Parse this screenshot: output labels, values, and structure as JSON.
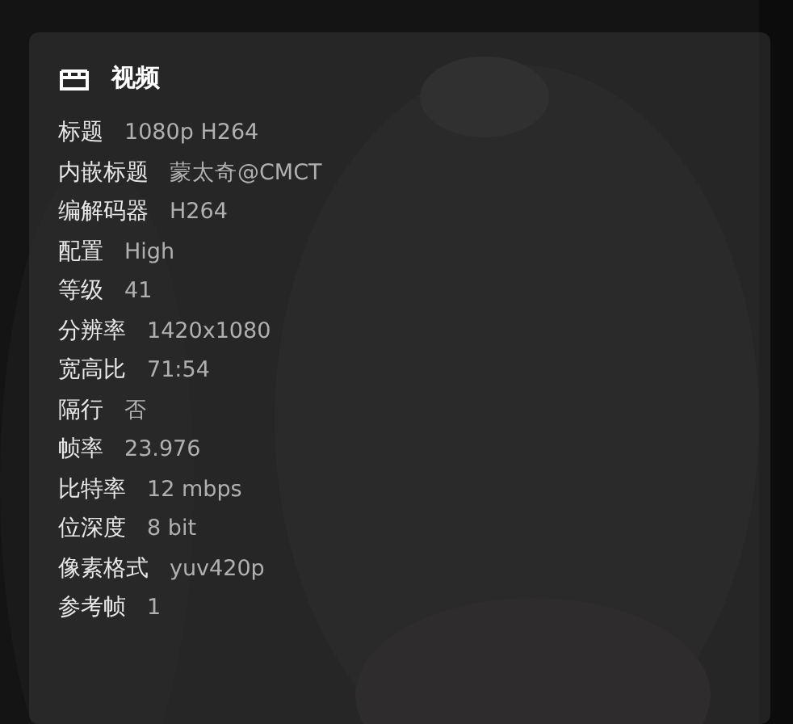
{
  "panel": {
    "title": "视频",
    "rows": [
      {
        "label": "标题",
        "value": "1080p H264"
      },
      {
        "label": "内嵌标题",
        "value": "蒙太奇@CMCT"
      },
      {
        "label": "编解码器",
        "value": "H264"
      },
      {
        "label": "配置",
        "value": "High"
      },
      {
        "label": "等级",
        "value": "41"
      },
      {
        "label": "分辨率",
        "value": "1420x1080"
      },
      {
        "label": "宽高比",
        "value": "71:54"
      },
      {
        "label": "隔行",
        "value": "否"
      },
      {
        "label": "帧率",
        "value": "23.976"
      },
      {
        "label": "比特率",
        "value": "12 mbps"
      },
      {
        "label": "位深度",
        "value": "8 bit"
      },
      {
        "label": "像素格式",
        "value": "yuv420p"
      },
      {
        "label": "参考帧",
        "value": "1"
      }
    ]
  }
}
